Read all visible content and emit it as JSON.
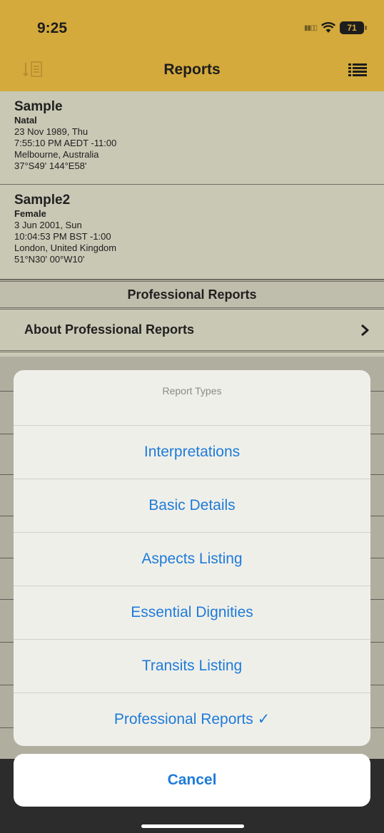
{
  "status": {
    "time": "9:25",
    "battery": "71"
  },
  "nav": {
    "title": "Reports"
  },
  "people": [
    {
      "name": "Sample",
      "type": "Natal",
      "date": "23 Nov 1989, Thu",
      "time": "7:55:10 PM AEDT -11:00",
      "place": "Melbourne, Australia",
      "coords": "37°S49' 144°E58'"
    },
    {
      "name": "Sample2",
      "type": "Female",
      "date": "3 Jun 2001, Sun",
      "time": "10:04:53 PM BST -1:00",
      "place": "London, United Kingdom",
      "coords": "51°N30' 00°W10'"
    }
  ],
  "section": {
    "title": "Professional Reports"
  },
  "about_row": {
    "label": "About Professional Reports"
  },
  "sheet": {
    "title": "Report Types",
    "items": [
      "Interpretations",
      "Basic Details",
      "Aspects Listing",
      "Essential Dignities",
      "Transits Listing",
      "Professional Reports ✓"
    ],
    "cancel": "Cancel"
  },
  "colors": {
    "accent": "#d4aa3c",
    "action": "#1e7bd8",
    "list_bg": "#c9c8b5"
  },
  "icons": {
    "left": "text-indent-icon",
    "right": "list-menu-icon",
    "row": "chevron-right-icon"
  }
}
